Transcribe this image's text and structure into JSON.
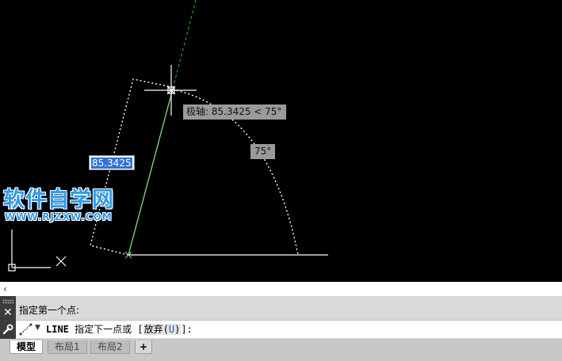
{
  "drawing": {
    "polar_tooltip": "极轴: 85.3425 < 75°",
    "angle_label": "75°",
    "dynamic_input_value": "85.3425"
  },
  "watermark": {
    "title": "软件自学网",
    "url": "WWW.RJZXW.COM"
  },
  "command": {
    "history_line": "指定第一个点:",
    "command_name": "LINE",
    "prompt_text": "指定下一点或",
    "bracket_open": "[",
    "option_label": "放弃(",
    "option_key": "U",
    "option_close": ")",
    "bracket_close": "]:"
  },
  "tabs": {
    "model": "模型",
    "layout1": "布局1",
    "layout2": "布局2",
    "add": "+"
  },
  "colors": {
    "canvas_bg": "#000000",
    "line_green": "#7fe07f",
    "tooltip_bg": "#9a9a9a",
    "dyn_input_highlight": "#2f72d8"
  },
  "icons": {
    "crosshair": "crosshair-cursor-icon",
    "ucs": "ucs-axis-icon",
    "close": "close-icon",
    "customize": "wrench-icon",
    "line_command": "line-command-icon"
  }
}
